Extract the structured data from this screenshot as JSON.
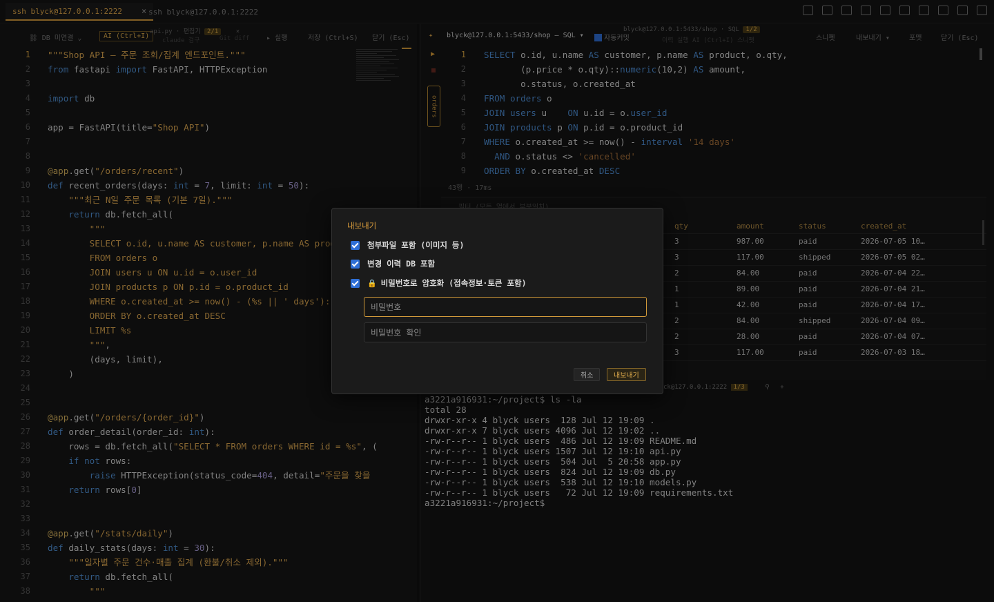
{
  "tabs": [
    {
      "label": "ssh blyck@127.0.0.1:2222",
      "active": true,
      "close": "×"
    },
    {
      "label": "ssh blyck@127.0.0.1:2222",
      "active": false
    }
  ],
  "left_toolbar": {
    "db": "DB 미연결",
    "ai": "AI (Ctrl+I)",
    "file": "api.py · 편집기",
    "file_badge": "2/1",
    "run": "실행",
    "save": "저장 (Ctrl+S)",
    "close": "닫기 (Esc)",
    "ghost1": "claude 검구",
    "ghost2": "Git diff"
  },
  "code": [
    {
      "n": "1",
      "html": "<span class=\"s\">\"\"\"Shop API — 주문 조회/집계 엔드포인트.\"\"\"</span>"
    },
    {
      "n": "2",
      "html": "<span class=\"k\">from</span> fastapi <span class=\"k\">import</span> FastAPI, HTTPException"
    },
    {
      "n": "3",
      "html": ""
    },
    {
      "n": "4",
      "html": "<span class=\"k\">import</span> db"
    },
    {
      "n": "5",
      "html": ""
    },
    {
      "n": "6",
      "html": "app = FastAPI(title=<span class=\"s\">\"Shop API\"</span>)"
    },
    {
      "n": "7",
      "html": ""
    },
    {
      "n": "8",
      "html": ""
    },
    {
      "n": "9",
      "html": "<span class=\"d\">@app</span>.get(<span class=\"s\">\"/orders/recent\"</span>)"
    },
    {
      "n": "10",
      "html": "<span class=\"k\">def</span> recent_orders(days: <span class=\"ty\">int</span> = <span class=\"n\">7</span>, limit: <span class=\"ty\">int</span> = <span class=\"n\">50</span>):"
    },
    {
      "n": "11",
      "html": "    <span class=\"s\">\"\"\"최근 N일 주문 목록 (기본 7일).\"\"\"</span>"
    },
    {
      "n": "12",
      "html": "    <span class=\"k\">return</span> db.fetch_all("
    },
    {
      "n": "13",
      "html": "        <span class=\"s\">\"\"\"</span>"
    },
    {
      "n": "14",
      "html": "<span class=\"s\">        SELECT o.id, u.name AS customer, p.name AS product,</span>"
    },
    {
      "n": "15",
      "html": "<span class=\"s\">        FROM orders o</span>"
    },
    {
      "n": "16",
      "html": "<span class=\"s\">        JOIN users u ON u.id = o.user_id</span>"
    },
    {
      "n": "17",
      "html": "<span class=\"s\">        JOIN products p ON p.id = o.product_id</span>"
    },
    {
      "n": "18",
      "html": "<span class=\"s\">        WHERE o.created_at &gt;= now() - (%s || ' days')::inte</span>"
    },
    {
      "n": "19",
      "html": "<span class=\"s\">        ORDER BY o.created_at DESC</span>"
    },
    {
      "n": "20",
      "html": "<span class=\"s\">        LIMIT %s</span>"
    },
    {
      "n": "21",
      "html": "<span class=\"s\">        \"\"\"</span>,"
    },
    {
      "n": "22",
      "html": "        (days, limit),"
    },
    {
      "n": "23",
      "html": "    )"
    },
    {
      "n": "24",
      "html": ""
    },
    {
      "n": "25",
      "html": ""
    },
    {
      "n": "26",
      "html": "<span class=\"d\">@app</span>.get(<span class=\"s\">\"/orders/{order_id}\"</span>)"
    },
    {
      "n": "27",
      "html": "<span class=\"k\">def</span> order_detail(order_id: <span class=\"ty\">int</span>):"
    },
    {
      "n": "28",
      "html": "    rows = db.fetch_all(<span class=\"s\">\"SELECT * FROM orders WHERE id = %s\"</span>, ("
    },
    {
      "n": "29",
      "html": "    <span class=\"k\">if not</span> rows:"
    },
    {
      "n": "30",
      "html": "        <span class=\"k\">raise</span> HTTPException(status_code=<span class=\"n\">404</span>, detail=<span class=\"s\">\"주문을 찾을</span>"
    },
    {
      "n": "31",
      "html": "    <span class=\"k\">return</span> rows[<span class=\"n\">0</span>]"
    },
    {
      "n": "32",
      "html": ""
    },
    {
      "n": "33",
      "html": ""
    },
    {
      "n": "34",
      "html": "<span class=\"d\">@app</span>.get(<span class=\"s\">\"/stats/daily\"</span>)"
    },
    {
      "n": "35",
      "html": "<span class=\"k\">def</span> daily_stats(days: <span class=\"ty\">int</span> = <span class=\"n\">30</span>):"
    },
    {
      "n": "36",
      "html": "    <span class=\"s\">\"\"\"일자별 주문 건수·매출 집계 (환불/취소 제외).\"\"\"</span>"
    },
    {
      "n": "37",
      "html": "    <span class=\"k\">return</span> db.fetch_all("
    },
    {
      "n": "38",
      "html": "        <span class=\"s\">\"\"\"</span>"
    }
  ],
  "right_toolbar": {
    "conn": "blyck@127.0.0.1:5433/shop — SQL",
    "autocommit": "자동커밋",
    "ghost_conn": "blyck@127.0.0.1:5433/shop · SQL",
    "ghost_badge": "1/2",
    "ghost_items": "이력    실행    AI (Ctrl+I)   스니펫",
    "snippet": "스니펫",
    "export": "내보내기",
    "format": "포맷",
    "close": "닫기 (Esc)"
  },
  "sql": [
    {
      "n": "1",
      "html": "<span class=\"sq\">SELECT</span> o.id, u.name <span class=\"sq\">AS</span> customer, p.name <span class=\"sq\">AS</span> product, o.qty,"
    },
    {
      "n": "2",
      "html": "       (p.price * o.qty)::<span class=\"sq\">numeric</span>(10,2) <span class=\"sq\">AS</span> amount,"
    },
    {
      "n": "3",
      "html": "       o.status, o.created_at"
    },
    {
      "n": "4",
      "html": "<span class=\"sq\">FROM</span> <span class=\"sq\">orders</span> o"
    },
    {
      "n": "5",
      "html": "<span class=\"sq\">JOIN</span> <span class=\"sq\">users</span> u    <span class=\"sq\">ON</span> u.id = o.<span class=\"sq\">user_id</span>"
    },
    {
      "n": "6",
      "html": "<span class=\"sq\">JOIN</span> <span class=\"sq\">products</span> p <span class=\"sq\">ON</span> p.id = o.product_id"
    },
    {
      "n": "7",
      "html": "<span class=\"sq\">WHERE</span> o.created_at &gt;= now() - <span class=\"sq\">interval</span> <span class=\"ss\">'14 days'</span>"
    },
    {
      "n": "8",
      "html": "  <span class=\"sq\">AND</span> o.status &lt;&gt; <span class=\"ss\">'cancelled'</span>"
    },
    {
      "n": "9",
      "html": "<span class=\"sq\">ORDER BY</span> o.created_at <span class=\"sq\">DESC</span>"
    }
  ],
  "side_tag": "orders",
  "query_status": "43행 · 17ms",
  "filter_placeholder": "필터 (모든 열에서 부분일치)",
  "results": {
    "columns": [
      "qty",
      "amount",
      "status",
      "created_at"
    ],
    "rows": [
      [
        "3",
        "987.00",
        "paid",
        "2026-07-05 10…"
      ],
      [
        "3",
        "117.00",
        "shipped",
        "2026-07-05 02…"
      ],
      [
        "2",
        "84.00",
        "paid",
        "2026-07-04 22…"
      ],
      [
        "1",
        "89.00",
        "paid",
        "2026-07-04 21…"
      ],
      [
        "1",
        "42.00",
        "paid",
        "2026-07-04 17…"
      ],
      [
        "2",
        "84.00",
        "shipped",
        "2026-07-04 09…"
      ],
      [
        "2",
        "28.00",
        "paid",
        "2026-07-04 07…"
      ],
      [
        "3",
        "117.00",
        "paid",
        "2026-07-03 18…"
      ]
    ]
  },
  "terminal_tab": "ck@127.0.0.1:2222",
  "terminal_badge": "1/3",
  "terminal": [
    "a3221a916931:~/project$ ls -la",
    "total 28",
    "drwxr-xr-x 4 blyck users  128 Jul 12 19:09 .",
    "drwxr-xr-x 7 blyck users 4096 Jul 12 19:02 ..",
    "-rw-r--r-- 1 blyck users  486 Jul 12 19:09 README.md",
    "-rw-r--r-- 1 blyck users 1507 Jul 12 19:10 api.py",
    "-rw-r--r-- 1 blyck users  504 Jul  5 20:58 app.py",
    "-rw-r--r-- 1 blyck users  824 Jul 12 19:09 db.py",
    "-rw-r--r-- 1 blyck users  538 Jul 12 19:10 models.py",
    "-rw-r--r-- 1 blyck users   72 Jul 12 19:09 requirements.txt",
    "a3221a916931:~/project$"
  ],
  "dialog": {
    "title": "내보내기",
    "opt_attach": "첨부파일 포함 (이미지 등)",
    "opt_history": "변경 이력 DB 포함",
    "opt_encrypt": "비밀번호로 암호화 (접속정보·토큰 포함)",
    "pw_placeholder": "비밀번호",
    "pw_confirm_placeholder": "비밀번호 확인",
    "cancel": "취소",
    "export": "내보내기"
  }
}
